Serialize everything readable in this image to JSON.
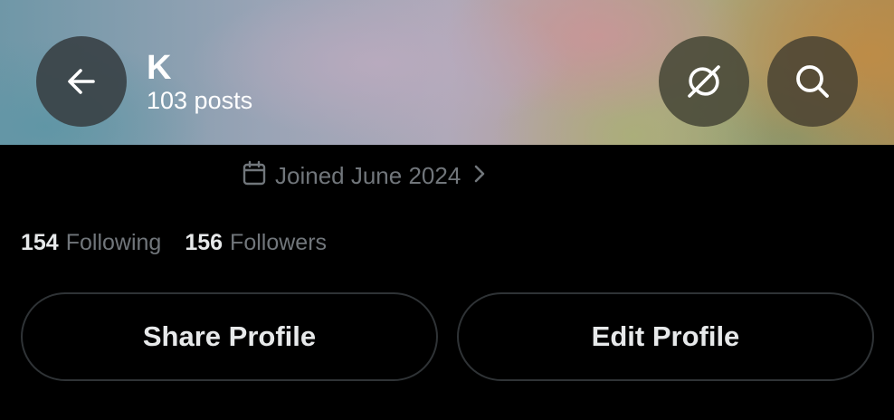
{
  "header": {
    "name": "K",
    "posts": "103 posts",
    "back_icon": "arrow-left-icon",
    "grok_icon": "grok-icon",
    "search_icon": "search-icon"
  },
  "profile": {
    "joined": "Joined June 2024",
    "joined_icon": "calendar-icon",
    "stats": {
      "following_count": "154",
      "following_label": "Following",
      "followers_count": "156",
      "followers_label": "Followers"
    }
  },
  "actions": {
    "share_label": "Share Profile",
    "edit_label": "Edit Profile"
  },
  "colors": {
    "background": "#000000",
    "muted_text": "#71767b",
    "primary_text": "#e7e9ea",
    "button_border": "#2f3336"
  }
}
